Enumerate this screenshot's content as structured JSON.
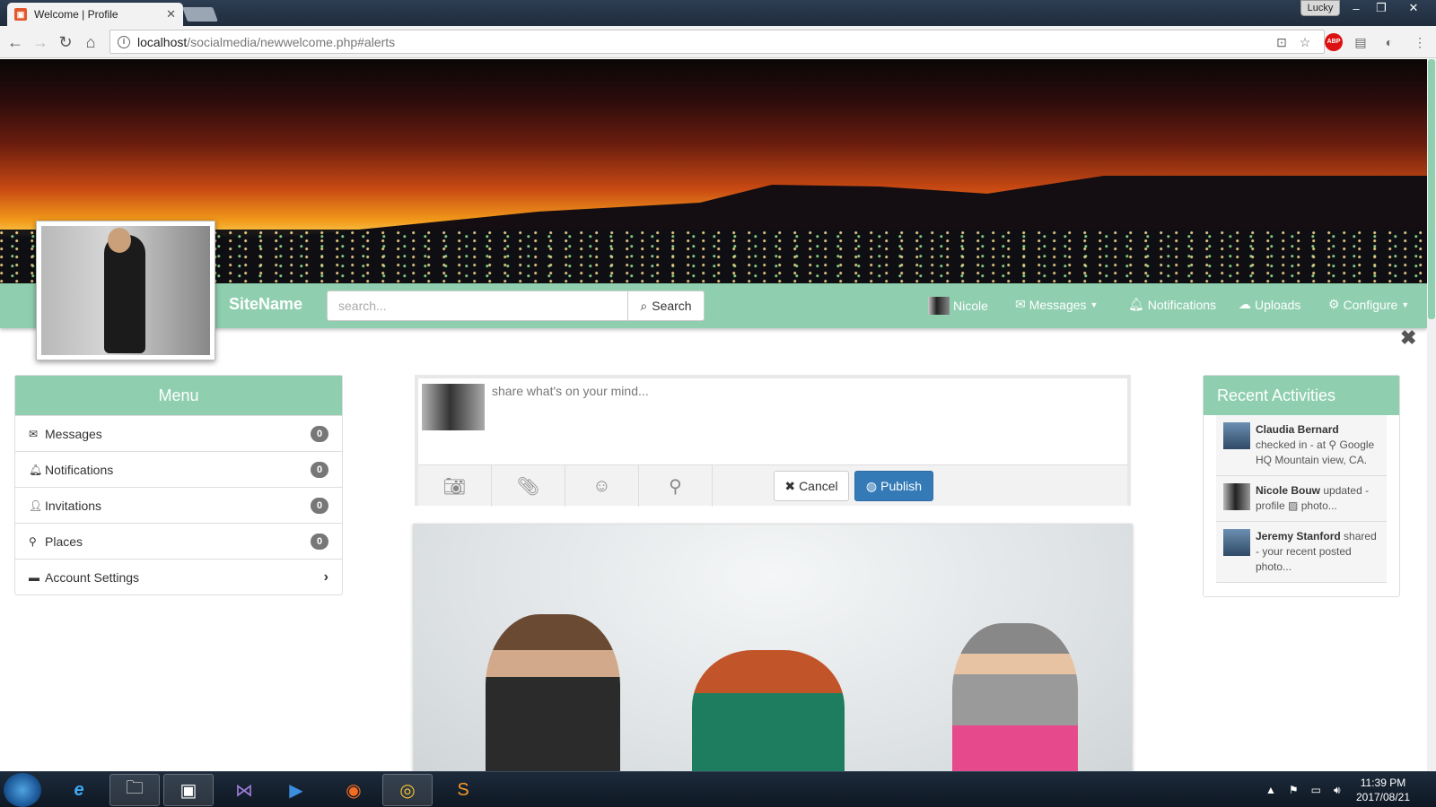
{
  "browser": {
    "tab_title": "Welcome | Profile",
    "tab_close": "✕",
    "profile_name": "Lucky",
    "url_host": "localhost",
    "url_path": "/socialmedia/newwelcome.php#alerts"
  },
  "navbar": {
    "brand": "SiteName",
    "search_placeholder": "search...",
    "search_button": "Search",
    "user": "Nicole",
    "messages": "Messages",
    "notifications": "Notifications",
    "uploads": "Uploads",
    "configure": "Configure"
  },
  "menu": {
    "title": "Menu",
    "items": [
      {
        "label": "Messages",
        "icon": "envelope-icon",
        "count": "0"
      },
      {
        "label": "Notifications",
        "icon": "bell-icon",
        "count": "0"
      },
      {
        "label": "Invitations",
        "icon": "user-plus-icon",
        "count": "0"
      },
      {
        "label": "Places",
        "icon": "map-marker-icon",
        "count": "0"
      },
      {
        "label": "Account Settings",
        "icon": "briefcase-icon",
        "count": ""
      }
    ]
  },
  "composer": {
    "placeholder": "share what's on your mind...",
    "cancel": "Cancel",
    "publish": "Publish"
  },
  "recent": {
    "title": "Recent Activities",
    "items": [
      {
        "name": "Claudia Bernard",
        "text": "checked in - at",
        "place": "Google HQ Mountain view, CA."
      },
      {
        "name": "Nicole Bouw",
        "text": "updated - profile",
        "tail": "photo..."
      },
      {
        "name": "Jeremy Stanford",
        "text": "shared - your recent posted photo..."
      }
    ]
  },
  "taskbar": {
    "time": "11:39 PM",
    "date": "2017/08/21"
  },
  "colors": {
    "accent": "#8fcfaf",
    "publish": "#337ab7",
    "badge": "#777777"
  }
}
